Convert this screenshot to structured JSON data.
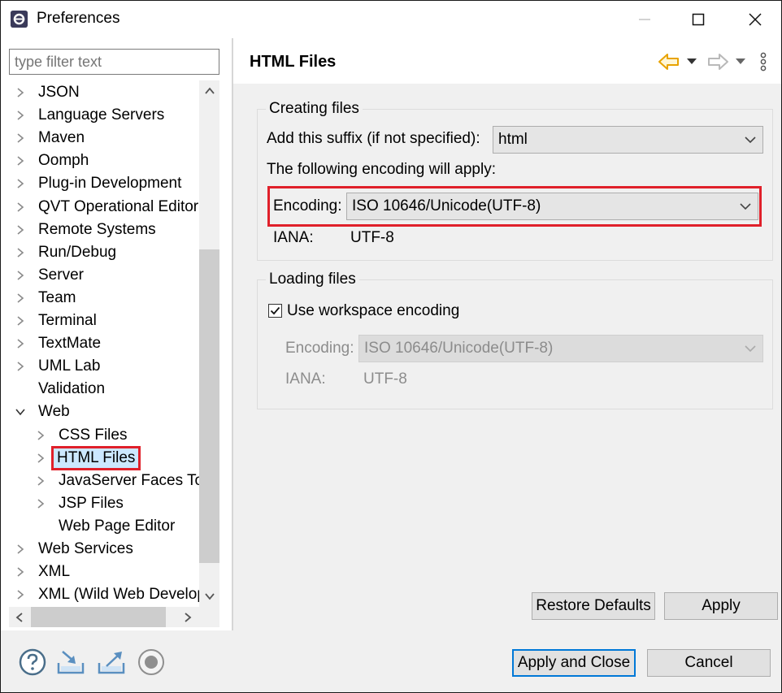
{
  "window": {
    "title": "Preferences"
  },
  "filter": {
    "placeholder": "type filter text"
  },
  "tree": {
    "items": [
      {
        "label": "JSON",
        "depth": 0,
        "twisty": "collapsed"
      },
      {
        "label": "Language Servers",
        "depth": 0,
        "twisty": "collapsed"
      },
      {
        "label": "Maven",
        "depth": 0,
        "twisty": "collapsed"
      },
      {
        "label": "Oomph",
        "depth": 0,
        "twisty": "collapsed"
      },
      {
        "label": "Plug-in Development",
        "depth": 0,
        "twisty": "collapsed"
      },
      {
        "label": "QVT Operational Editor",
        "depth": 0,
        "twisty": "collapsed"
      },
      {
        "label": "Remote Systems",
        "depth": 0,
        "twisty": "collapsed"
      },
      {
        "label": "Run/Debug",
        "depth": 0,
        "twisty": "collapsed"
      },
      {
        "label": "Server",
        "depth": 0,
        "twisty": "collapsed"
      },
      {
        "label": "Team",
        "depth": 0,
        "twisty": "collapsed"
      },
      {
        "label": "Terminal",
        "depth": 0,
        "twisty": "collapsed"
      },
      {
        "label": "TextMate",
        "depth": 0,
        "twisty": "collapsed"
      },
      {
        "label": "UML Lab",
        "depth": 0,
        "twisty": "collapsed"
      },
      {
        "label": "Validation",
        "depth": 0,
        "twisty": "none"
      },
      {
        "label": "Web",
        "depth": 0,
        "twisty": "expanded"
      },
      {
        "label": "CSS Files",
        "depth": 1,
        "twisty": "collapsed"
      },
      {
        "label": "HTML Files",
        "depth": 1,
        "twisty": "collapsed",
        "selected": true
      },
      {
        "label": "JavaServer Faces Tools",
        "depth": 1,
        "twisty": "collapsed"
      },
      {
        "label": "JSP Files",
        "depth": 1,
        "twisty": "collapsed"
      },
      {
        "label": "Web Page Editor",
        "depth": 1,
        "twisty": "none"
      },
      {
        "label": "Web Services",
        "depth": 0,
        "twisty": "collapsed"
      },
      {
        "label": "XML",
        "depth": 0,
        "twisty": "collapsed"
      },
      {
        "label": "XML (Wild Web Developer)",
        "depth": 0,
        "twisty": "collapsed"
      }
    ]
  },
  "page": {
    "title": "HTML Files",
    "creating": {
      "legend": "Creating files",
      "suffix_label": "Add this suffix (if not specified):",
      "suffix_value": "html",
      "encoding_note": "The following encoding will apply:",
      "encoding_label": "Encoding:",
      "encoding_value": "ISO 10646/Unicode(UTF-8)",
      "iana_label": "IANA:",
      "iana_value": "UTF-8"
    },
    "loading": {
      "legend": "Loading files",
      "use_workspace_label": "Use workspace encoding",
      "use_workspace_checked": true,
      "encoding_label": "Encoding:",
      "encoding_value": "ISO 10646/Unicode(UTF-8)",
      "iana_label": "IANA:",
      "iana_value": "UTF-8"
    },
    "restore_defaults": "Restore Defaults",
    "apply": "Apply"
  },
  "footer": {
    "apply_and_close": "Apply and Close",
    "cancel": "Cancel"
  },
  "colors": {
    "highlight": "#e0202a",
    "selection": "#cce8ff",
    "accent": "#0078d7",
    "nav_back": "#e8a300"
  }
}
